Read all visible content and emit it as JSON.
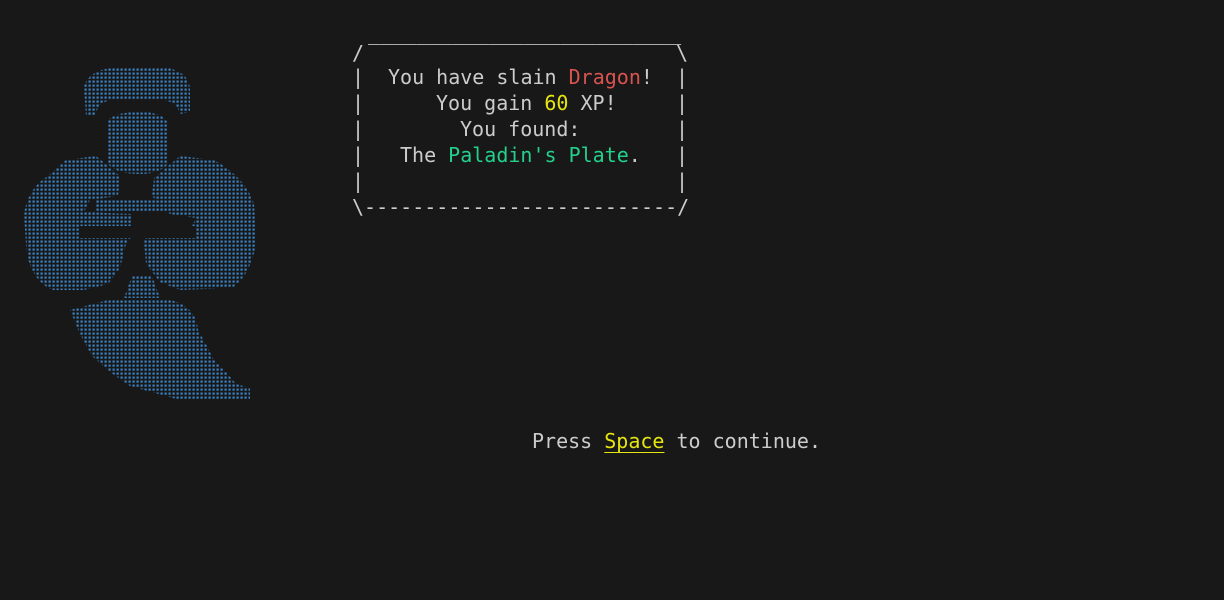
{
  "box": {
    "top_border": " __________________________",
    "top_left": "/",
    "top_right": "\\",
    "side": "|",
    "bottom_border": "\\--------------------------/",
    "line1": {
      "prefix": "You have slain ",
      "monster": "Dragon",
      "suffix": "!"
    },
    "line2": {
      "prefix": "You gain ",
      "xp": "60",
      "suffix": " XP!"
    },
    "line3": {
      "text": "You found:"
    },
    "line4": {
      "prefix": "The ",
      "item": "Paladin's Plate",
      "suffix": "."
    }
  },
  "prompt": {
    "prefix": "Press ",
    "key": "Space",
    "suffix": " to continue."
  },
  "art": {
    "name": "dragon-ascii-art",
    "color": "#3b82c4"
  },
  "colors": {
    "background": "#181818",
    "text": "#cccccc",
    "monster": "#d9534f",
    "xp": "#e5e510",
    "item": "#23d18b",
    "key": "#e5e510"
  }
}
